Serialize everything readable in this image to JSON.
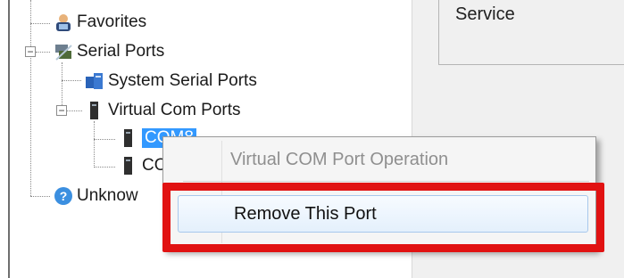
{
  "tree": {
    "favorites": "Favorites",
    "serial_ports": "Serial Ports",
    "system_serial_ports": "System Serial Ports",
    "virtual_com_ports": "Virtual Com Ports",
    "com_selected": "COM8",
    "com_second": "CO",
    "unknown": "Unknow"
  },
  "right_pane": {
    "service_label": "Service"
  },
  "context_menu": {
    "header": "Virtual COM Port Operation",
    "remove_item": "Remove This Port"
  },
  "colors": {
    "selection": "#3399ff",
    "highlight_border": "#e11212",
    "menu_hover": "#e4f0fc"
  }
}
